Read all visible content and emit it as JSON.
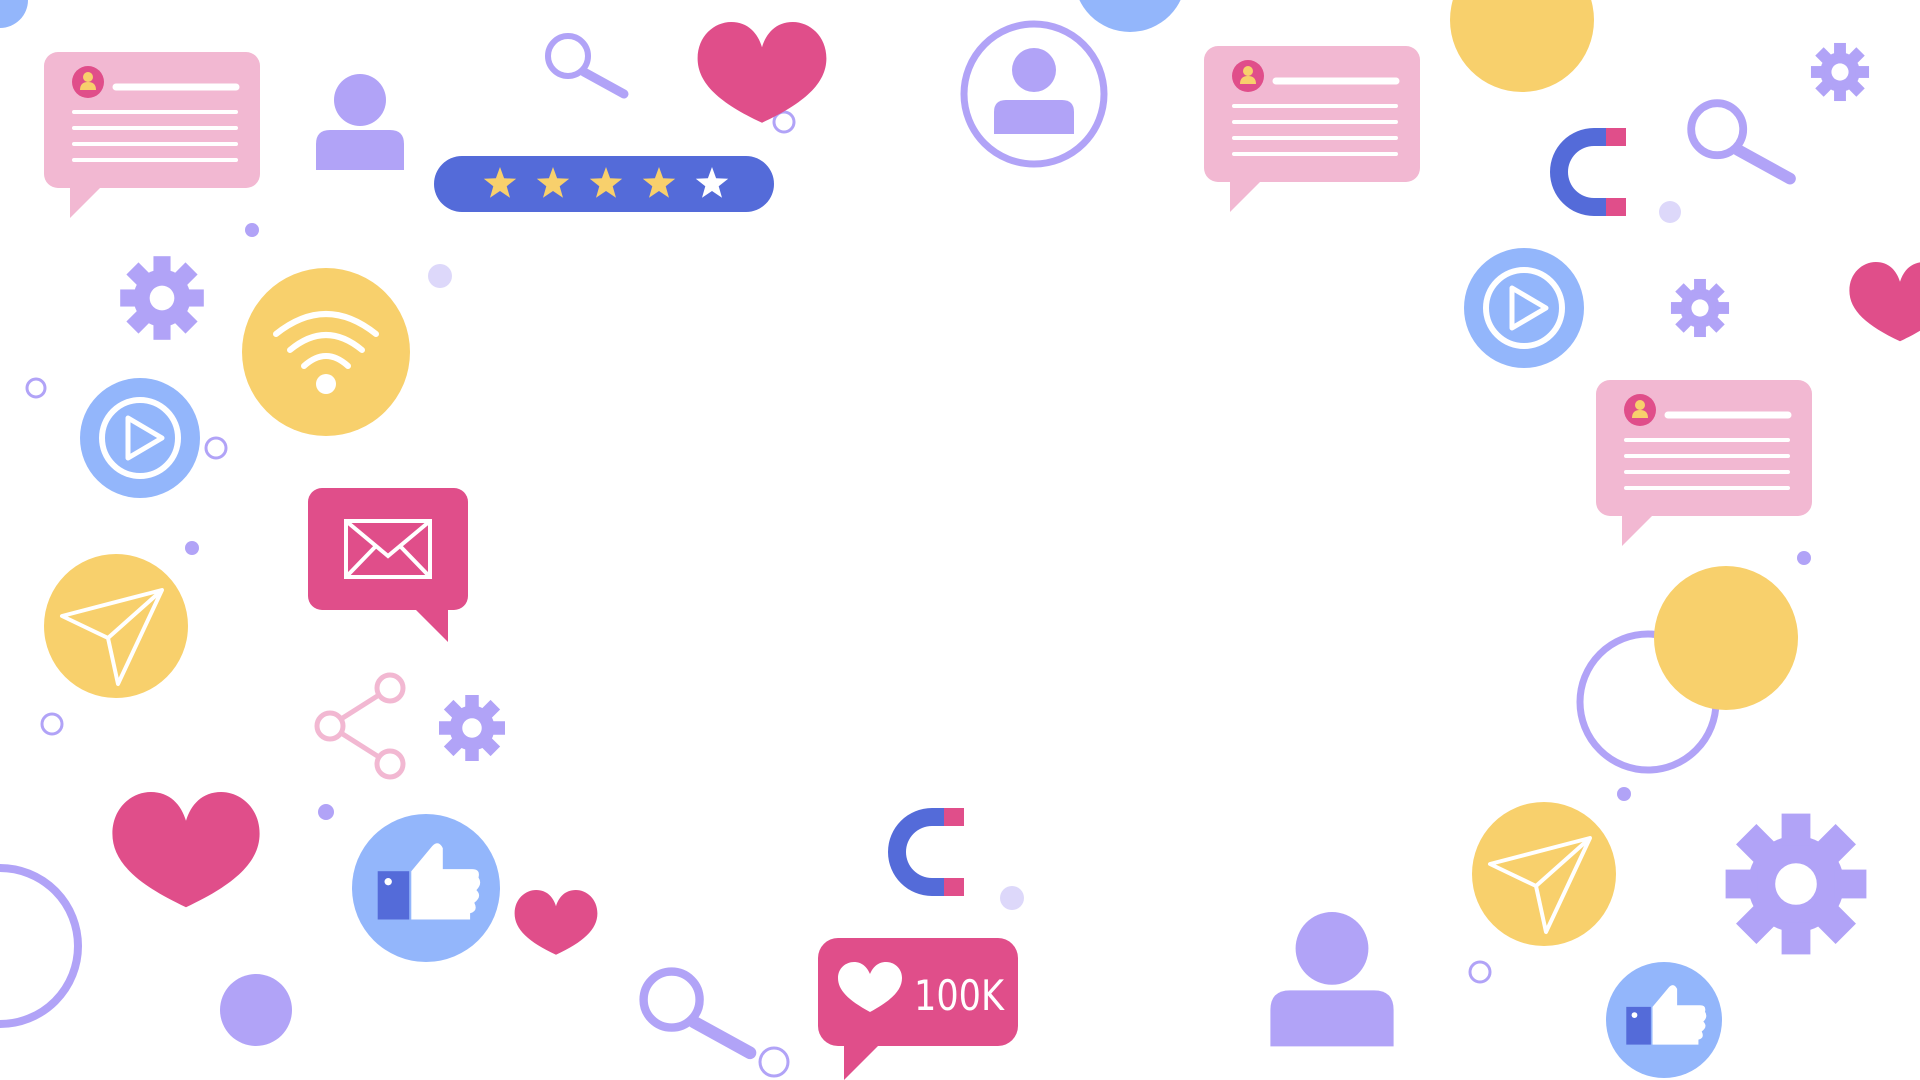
{
  "colors": {
    "pink": "#F2B8D2",
    "magenta": "#E04E8A",
    "lavender": "#B1A3F7",
    "light_blue": "#93B6FB",
    "royal_blue": "#546BD9",
    "yellow": "#F8D06C",
    "white": "#FFFFFF"
  },
  "rating": {
    "stars_total": 5,
    "stars_filled": 4
  },
  "counter": {
    "label": "100K"
  },
  "icons": [
    "comment-bubble-icon",
    "user-icon",
    "magnifier-icon",
    "heart-icon",
    "star-rating-icon",
    "profile-avatar-icon",
    "magnet-icon",
    "gear-icon",
    "wifi-icon",
    "play-button-icon",
    "paper-plane-icon",
    "mail-bubble-icon",
    "share-icon",
    "thumbs-up-icon",
    "like-counter-icon",
    "ring-icon",
    "dot-icon"
  ]
}
